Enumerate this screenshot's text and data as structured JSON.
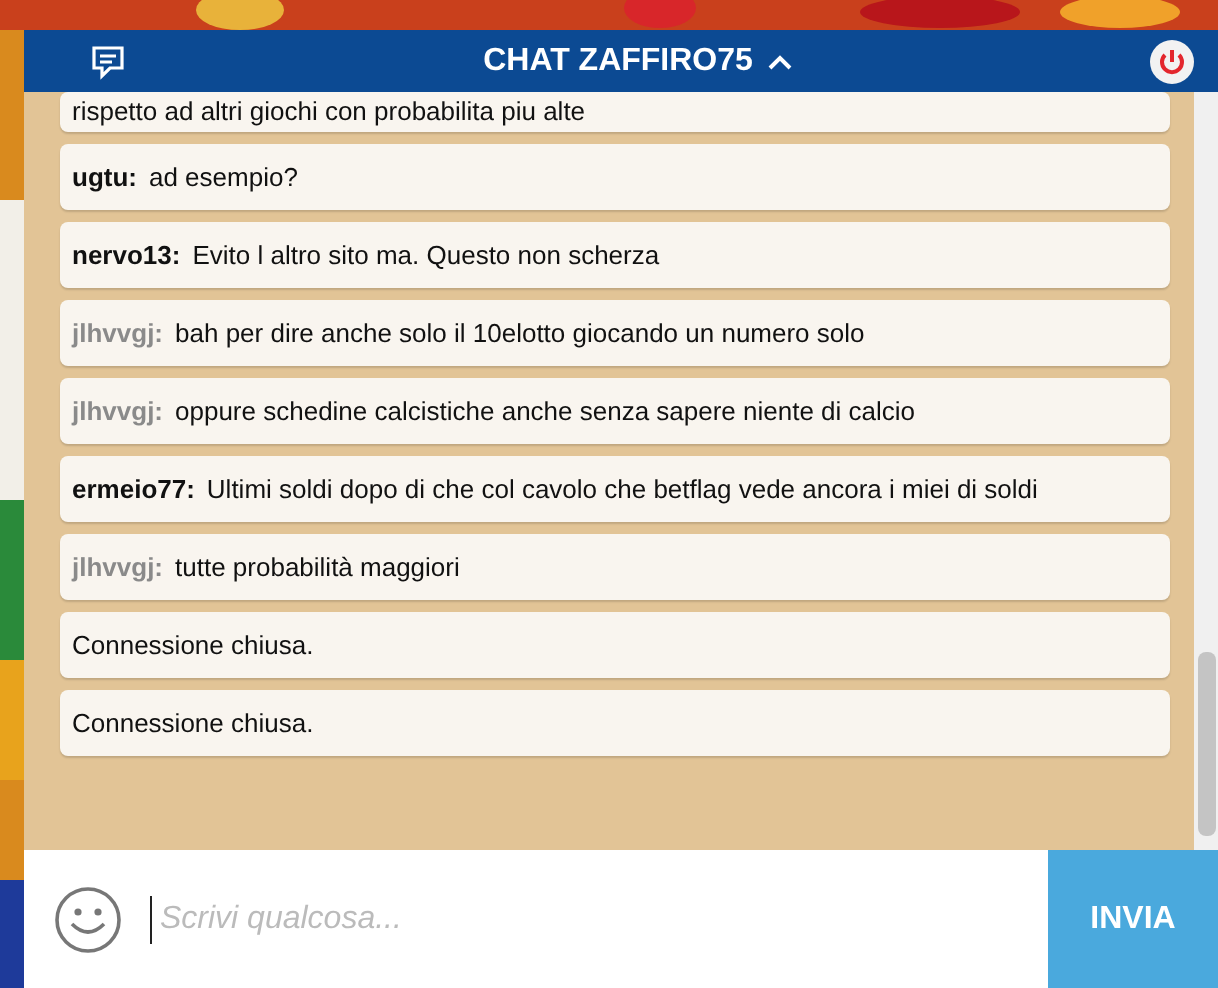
{
  "header": {
    "title": "CHAT ZAFFIRO75"
  },
  "messages": [
    {
      "kind": "cut",
      "text": "rispetto ad altri giochi con probabilita piu alte"
    },
    {
      "kind": "user",
      "author": "ugtu:",
      "faded": false,
      "text": "ad esempio?"
    },
    {
      "kind": "user",
      "author": "nervo13:",
      "faded": false,
      "text": "Evito l altro sito ma. Questo non scherza"
    },
    {
      "kind": "user",
      "author": "jlhvvgj:",
      "faded": true,
      "text": "bah per dire anche solo il 10elotto giocando un numero solo"
    },
    {
      "kind": "user",
      "author": "jlhvvgj:",
      "faded": true,
      "text": "oppure schedine calcistiche anche senza sapere niente di calcio"
    },
    {
      "kind": "user",
      "author": "ermeio77:",
      "faded": false,
      "text": "Ultimi soldi dopo di che col cavolo che betflag vede ancora i miei di soldi"
    },
    {
      "kind": "user",
      "author": "jlhvvgj:",
      "faded": true,
      "text": "tutte probabilità maggiori"
    },
    {
      "kind": "system",
      "text": "Connessione chiusa."
    },
    {
      "kind": "system",
      "text": "Connessione chiusa."
    }
  ],
  "composer": {
    "placeholder": "Scrivi qualcosa...",
    "send": "INVIA"
  }
}
